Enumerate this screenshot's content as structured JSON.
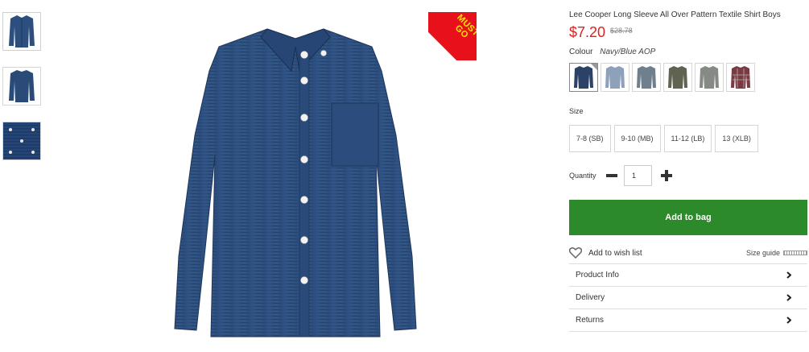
{
  "product": {
    "title": "Lee Cooper Long Sleeve All Over Pattern Textile Shirt Boys",
    "price": "$7.20",
    "old_price": "$28.78",
    "badge_line1": "MUST",
    "badge_line2": "GO",
    "colour_label": "Colour",
    "colour_name": "Navy/Blue AOP",
    "size_label": "Size",
    "sizes": [
      "7-8 (SB)",
      "9-10 (MB)",
      "11-12 (LB)",
      "13 (XLB)"
    ],
    "quantity_label": "Quantity",
    "quantity_value": "1",
    "add_to_bag": "Add to bag",
    "wish_list": "Add to wish list",
    "size_guide": "Size guide",
    "accordion": [
      "Product Info",
      "Delivery",
      "Returns"
    ]
  },
  "swatches": [
    {
      "name": "navy",
      "color": "#2b4266"
    },
    {
      "name": "light-blue",
      "color": "#8da2ba"
    },
    {
      "name": "grey-blue",
      "color": "#6f7f8e"
    },
    {
      "name": "olive",
      "color": "#5f6350"
    },
    {
      "name": "grey",
      "color": "#868a84"
    },
    {
      "name": "red-check",
      "color": "#7a3a44"
    }
  ],
  "colors": {
    "price": "#e02020",
    "add_button": "#2c8a2a",
    "badge": "#e8101a",
    "badge_text": "#ffe600",
    "shirt": "#2d4f7f"
  }
}
